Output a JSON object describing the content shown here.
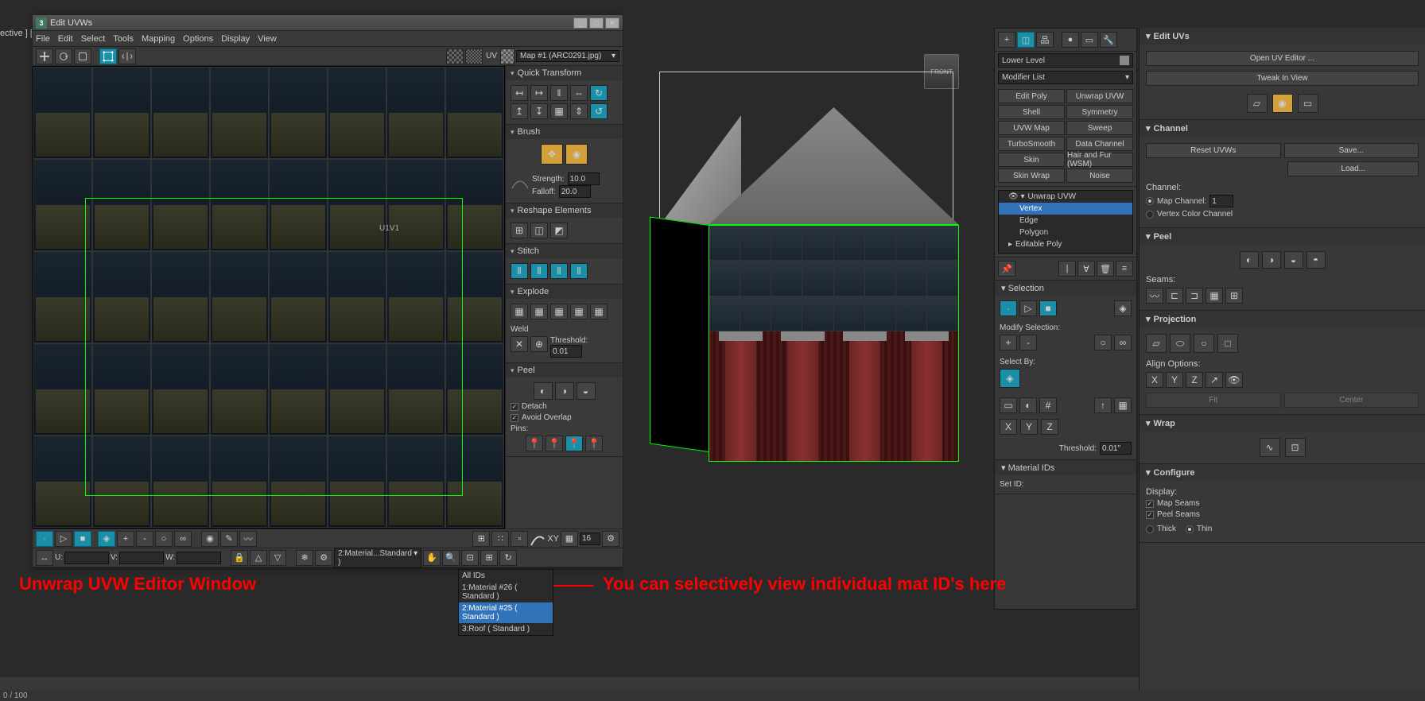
{
  "perspective_label": "ective ] [S",
  "uvw_window": {
    "title": "Edit UVWs",
    "app_icon_label": "3",
    "menu": [
      "File",
      "Edit",
      "Select",
      "Tools",
      "Mapping",
      "Options",
      "Display",
      "View"
    ],
    "uv_toggle": "UV",
    "checker_label": "CheckerPattern",
    "map_dropdown": "Map #1 (ARC0291.jpg)",
    "uv_tile_label": "U1V1",
    "rollouts": {
      "quick_transform": "Quick Transform",
      "brush": "Brush",
      "brush_strength_label": "Strength:",
      "brush_strength": "10.0",
      "brush_falloff_label": "Falloff:",
      "brush_falloff": "20.0",
      "reshape": "Reshape Elements",
      "stitch": "Stitch",
      "explode": "Explode",
      "weld_label": "Weld",
      "threshold_label": "Threshold:",
      "threshold": "0.01",
      "peel": "Peel",
      "detach": "Detach",
      "avoid_overlap": "Avoid Overlap",
      "pins": "Pins:"
    },
    "bottom_axis": "XY",
    "bottom_num": "16",
    "coord_u": "U:",
    "coord_v": "V:",
    "coord_w": "W:",
    "material_dropdown": "2:Material...Standard )"
  },
  "mat_popup": {
    "opt1": "All IDs",
    "opt2": "1:Material #26  ( Standard )",
    "opt3": "2:Material #25  ( Standard )",
    "opt4": "3:Roof  ( Standard )"
  },
  "modifier_panel": {
    "name_field": "Lower Level",
    "list_label": "Modifier List",
    "buttons": [
      "Edit Poly",
      "Unwrap UVW",
      "Shell",
      "Symmetry",
      "UVW Map",
      "Sweep",
      "TurboSmooth",
      "Data Channel",
      "Skin",
      "Hair and Fur (WSM)",
      "Skin Wrap",
      "Noise"
    ],
    "stack": {
      "item1": "Unwrap UVW",
      "sub1": "Vertex",
      "sub2": "Edge",
      "sub3": "Polygon",
      "item2": "Editable Poly"
    },
    "selection_hdr": "Selection",
    "modify_sel": "Modify Selection:",
    "select_by": "Select By:",
    "threshold_label": "Threshold:",
    "threshold": "0.01\"",
    "material_ids_hdr": "Material IDs",
    "set_id": "Set ID:"
  },
  "cmd_panel": {
    "edit_uvs_hdr": "Edit UVs",
    "open_editor": "Open UV Editor ...",
    "tweak": "Tweak In View",
    "channel_hdr": "Channel",
    "reset": "Reset UVWs",
    "save": "Save...",
    "load": "Load...",
    "channel_label": "Channel:",
    "map_channel": "Map Channel:",
    "map_channel_val": "1",
    "vertex_color": "Vertex Color Channel",
    "peel_hdr": "Peel",
    "seams_label": "Seams:",
    "projection_hdr": "Projection",
    "align_label": "Align Options:",
    "axis_x": "X",
    "axis_y": "Y",
    "axis_z": "Z",
    "fit": "Fit",
    "center": "Center",
    "wrap_hdr": "Wrap",
    "configure_hdr": "Configure",
    "display_label": "Display:",
    "map_seams": "Map Seams",
    "peel_seams": "Peel Seams",
    "thick": "Thick",
    "thin": "Thin"
  },
  "viewcube": "FRONT",
  "annotations": {
    "left": "Unwrap UVW Editor Window",
    "right": "You can selectively view individual mat ID's here"
  },
  "status": "0 / 100"
}
